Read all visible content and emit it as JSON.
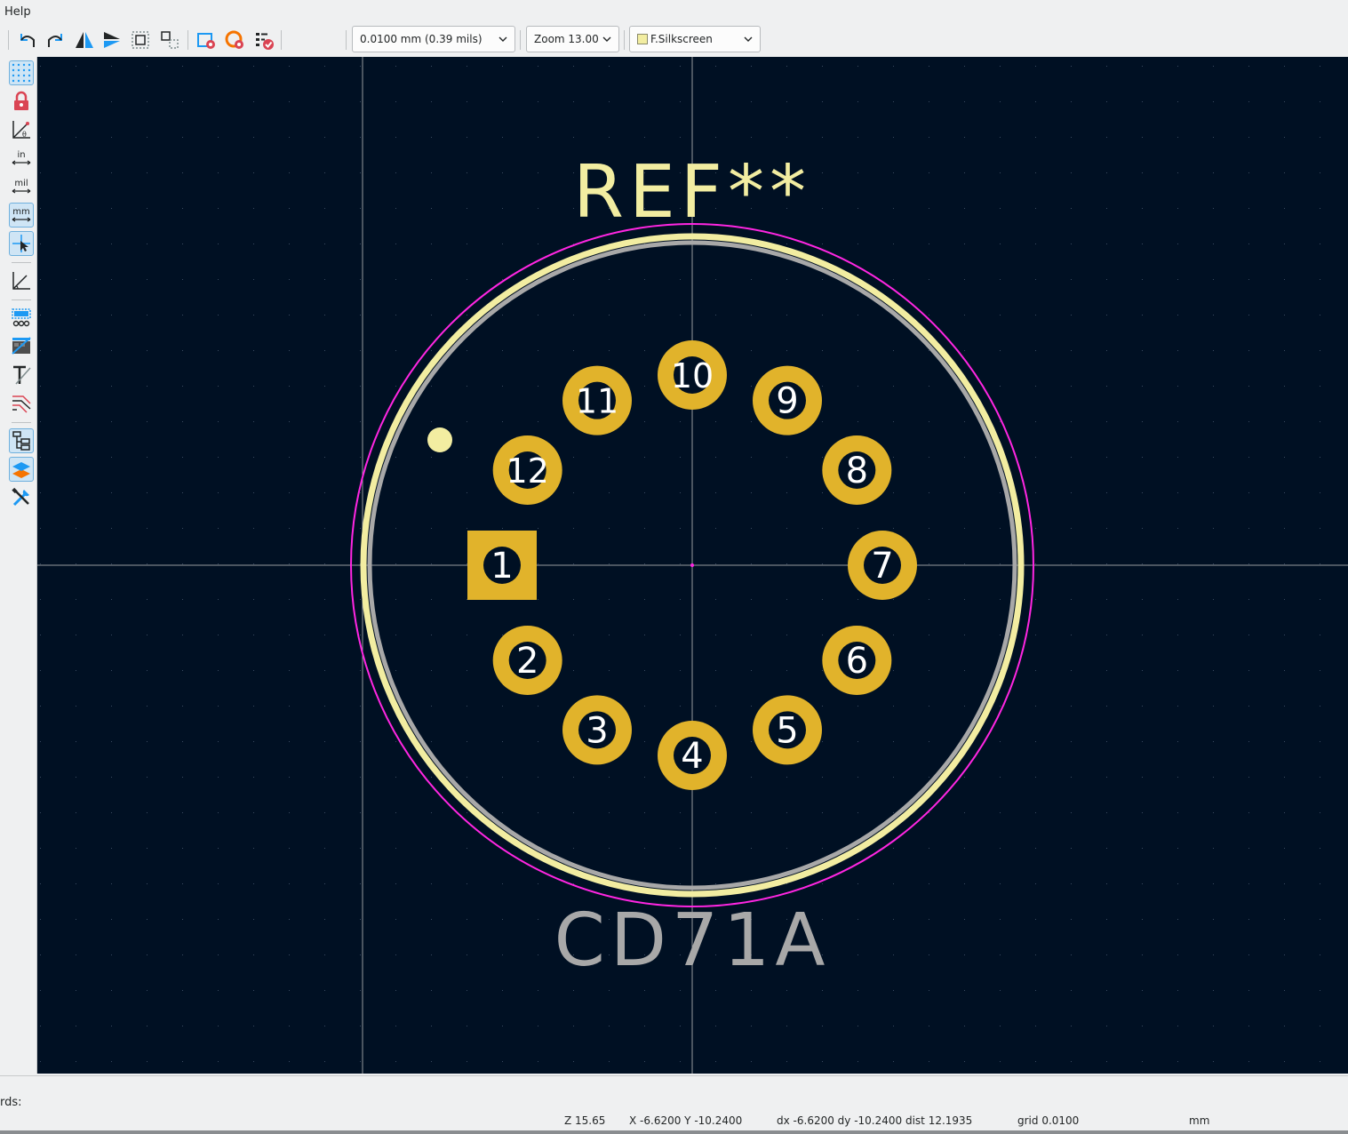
{
  "menubar": {
    "help": "Help"
  },
  "toolbar": {
    "grid_select": "0.0100 mm (0.39 mils)",
    "zoom_select": "Zoom 13.00",
    "layer_select": "F.Silkscreen",
    "buttons": [
      "undo-icon",
      "redo-icon",
      "mirror-h-icon",
      "mirror-v-icon",
      "group-icon",
      "ungroup-icon",
      "footprint-properties-icon",
      "pad-properties-icon",
      "footprint-checker-icon"
    ]
  },
  "left_toolbar": {
    "buttons": [
      "grid-icon",
      "grid-lock-icon",
      "polar-coords-icon",
      "units-inch-icon",
      "units-mil-icon",
      "units-mm-icon",
      "cursor-icon",
      "measure-icon",
      "pad-display-icon",
      "graphics-display-icon",
      "text-display-icon",
      "outline-display-icon",
      "hierarchy-icon",
      "layers-icon",
      "settings-icon"
    ],
    "labels": {
      "in": "in",
      "mil": "mil",
      "mm": "mm"
    }
  },
  "footprint": {
    "reference": "REF**",
    "value": "CD71A",
    "pads": [
      "1",
      "2",
      "3",
      "4",
      "5",
      "6",
      "7",
      "8",
      "9",
      "10",
      "11",
      "12"
    ],
    "colors": {
      "background": "#001023",
      "pad": "#e1b32b",
      "silk": "#f2eda1",
      "fab": "#a8a8a8",
      "courtyard": "#ff26e2",
      "crosshair": "#c8c8c8"
    }
  },
  "message_panel": {
    "label": "rds:"
  },
  "status": {
    "zoom": "Z 15.65",
    "coords": "X -6.6200  Y -10.2400",
    "delta": "dx -6.6200  dy -10.2400  dist 12.1935",
    "grid": "grid 0.0100",
    "units": "mm"
  }
}
